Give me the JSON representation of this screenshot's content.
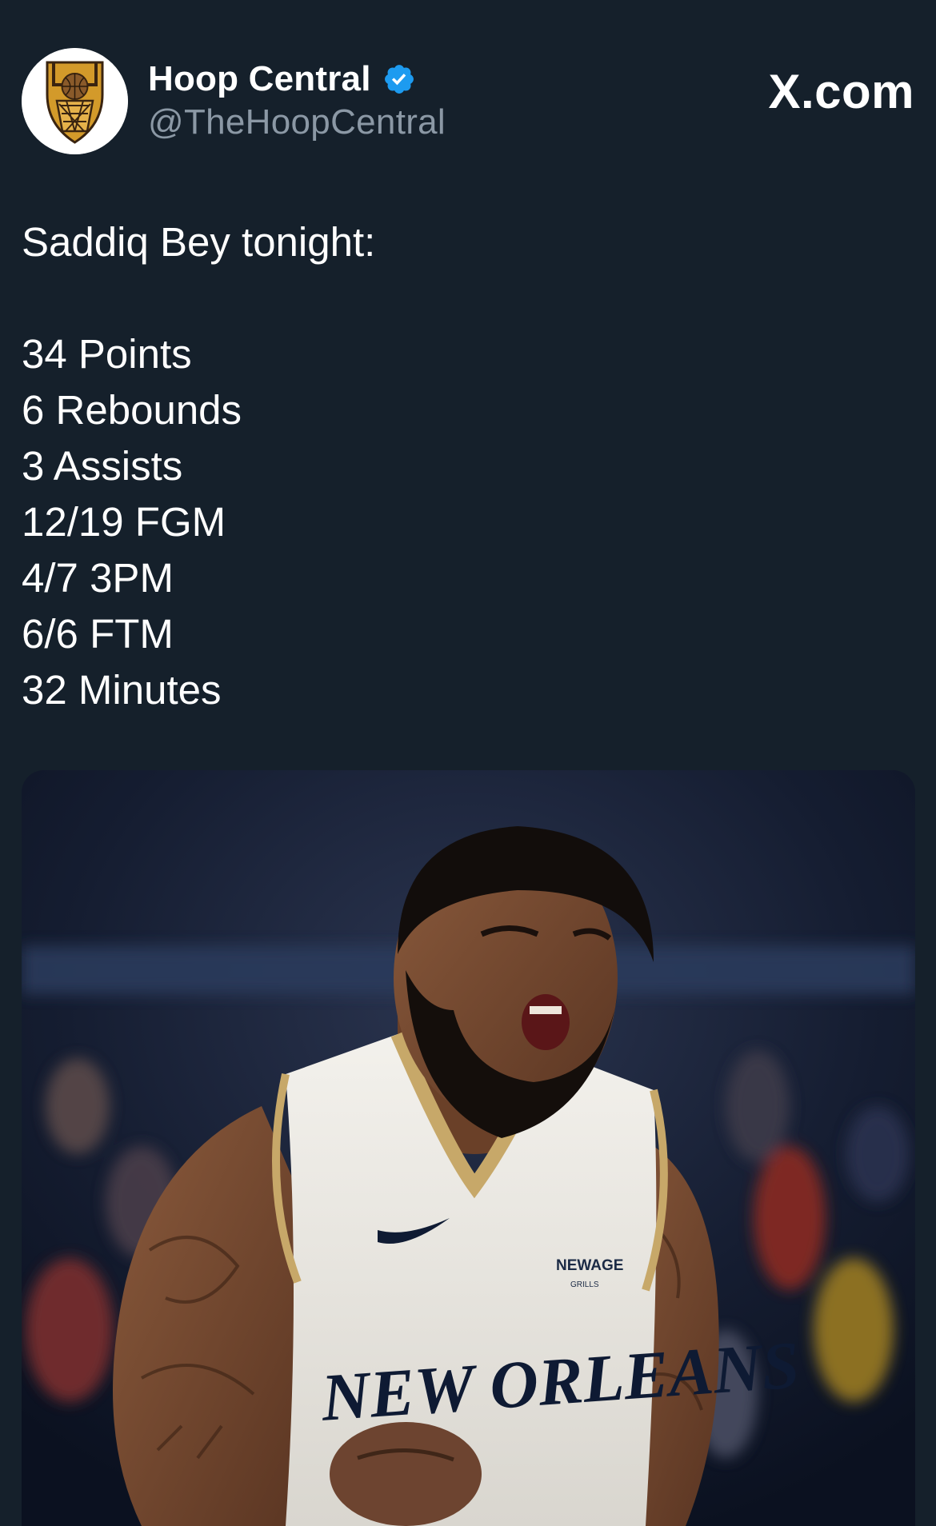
{
  "account": {
    "display_name": "Hoop Central",
    "handle": "@TheHoopCentral",
    "verified_icon": "verified-badge-icon",
    "avatar_icon": "hoop-central-logo-icon"
  },
  "source_label": "X.com",
  "tweet": {
    "intro": "Saddiq Bey tonight:",
    "stats": [
      "34 Points",
      "6 Rebounds",
      "3 Assists",
      "12/19 FGM",
      "4/7 3PM",
      "6/6 FTM",
      "32 Minutes"
    ]
  },
  "media": {
    "jersey_text": "NEW ORLEANS",
    "jersey_sponsor": "NEWAGE",
    "jersey_sponsor_sub": "GRILLS"
  },
  "colors": {
    "background": "#15202b",
    "handle_gray": "#8b98a5",
    "verified_blue": "#1d9bf0",
    "logo_gold": "#c99a2e"
  }
}
